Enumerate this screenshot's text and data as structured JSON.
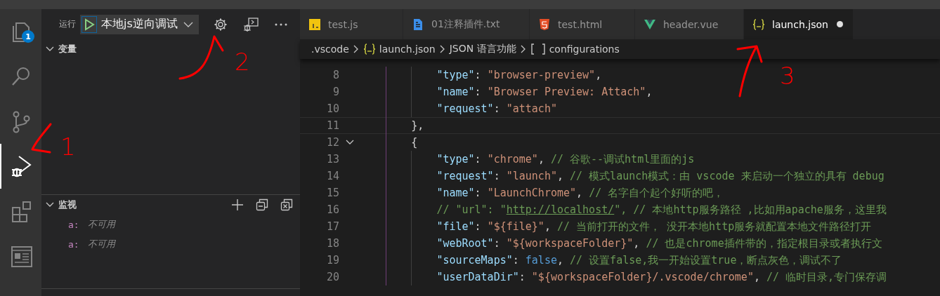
{
  "activity_bar": [
    {
      "kind": "explorer",
      "selected": false,
      "badge": "1"
    },
    {
      "kind": "search",
      "selected": false
    },
    {
      "kind": "source-control",
      "selected": false
    },
    {
      "kind": "run-debug",
      "selected": true
    },
    {
      "kind": "extensions",
      "selected": false
    },
    {
      "kind": "preview",
      "selected": false
    }
  ],
  "sidebar": {
    "title": "运行",
    "run_config": "本地js逆向调试",
    "sections": [
      {
        "title": "变量",
        "expanded": true
      },
      {
        "title": "监视",
        "expanded": true,
        "items": [
          {
            "name": "a:",
            "value": "不可用"
          },
          {
            "name": "a:",
            "value": "不可用"
          }
        ]
      }
    ]
  },
  "tabs": [
    {
      "label": "test.js",
      "kind": "js",
      "selected": false,
      "modified": false
    },
    {
      "label": "01注释插件.txt",
      "kind": "text",
      "selected": false,
      "modified": false
    },
    {
      "label": "test.html",
      "kind": "html",
      "selected": false,
      "modified": false
    },
    {
      "label": "header.vue",
      "kind": "vue",
      "selected": false,
      "modified": false
    },
    {
      "label": "launch.json",
      "kind": "json",
      "selected": true,
      "modified": true
    }
  ],
  "breadcrumbs": [
    {
      "label": ".vscode",
      "kind": "folder"
    },
    {
      "label": "launch.json",
      "kind": "json"
    },
    {
      "label": "JSON 语言功能",
      "kind": "section"
    },
    {
      "label": "configurations",
      "kind": "array"
    }
  ],
  "code": [
    {
      "number": "8",
      "foldable": false,
      "current": false,
      "tokens": [
        {
          "kind": "key",
          "text": "            \"type\""
        },
        {
          "kind": "punct",
          "text": ": "
        },
        {
          "kind": "string",
          "text": "\"browser-preview\""
        },
        {
          "kind": "punct",
          "text": ","
        }
      ]
    },
    {
      "number": "9",
      "foldable": false,
      "current": false,
      "tokens": [
        {
          "kind": "key",
          "text": "            \"name\""
        },
        {
          "kind": "punct",
          "text": ": "
        },
        {
          "kind": "string",
          "text": "\"Browser Preview: Attach\""
        },
        {
          "kind": "punct",
          "text": ","
        }
      ]
    },
    {
      "number": "10",
      "foldable": false,
      "current": false,
      "tokens": [
        {
          "kind": "key",
          "text": "            \"request\""
        },
        {
          "kind": "punct",
          "text": ": "
        },
        {
          "kind": "string",
          "text": "\"attach\""
        }
      ]
    },
    {
      "number": "11",
      "foldable": false,
      "current": true,
      "tokens": [
        {
          "kind": "punct",
          "text": "        },"
        }
      ]
    },
    {
      "number": "12",
      "foldable": true,
      "current": false,
      "tokens": [
        {
          "kind": "punct",
          "text": "        {"
        }
      ]
    },
    {
      "number": "13",
      "foldable": false,
      "current": false,
      "tokens": [
        {
          "kind": "key",
          "text": "            \"type\""
        },
        {
          "kind": "punct",
          "text": ": "
        },
        {
          "kind": "string",
          "text": "\"chrome\""
        },
        {
          "kind": "punct",
          "text": ", "
        },
        {
          "kind": "comment",
          "text": "// 谷歌--调试html里面的js"
        }
      ]
    },
    {
      "number": "14",
      "foldable": false,
      "current": false,
      "tokens": [
        {
          "kind": "key",
          "text": "            \"request\""
        },
        {
          "kind": "punct",
          "text": ": "
        },
        {
          "kind": "string",
          "text": "\"launch\""
        },
        {
          "kind": "punct",
          "text": ", "
        },
        {
          "kind": "comment",
          "text": "// 模式launch模式：由 vscode 来启动一个独立的具有 debug"
        }
      ]
    },
    {
      "number": "15",
      "foldable": false,
      "current": false,
      "tokens": [
        {
          "kind": "key",
          "text": "            \"name\""
        },
        {
          "kind": "punct",
          "text": ": "
        },
        {
          "kind": "string",
          "text": "\"LaunchChrome\""
        },
        {
          "kind": "punct",
          "text": ", "
        },
        {
          "kind": "comment",
          "text": "// 名字自个起个好听的吧，"
        }
      ]
    },
    {
      "number": "16",
      "foldable": false,
      "current": false,
      "tokens": [
        {
          "kind": "comment",
          "text": "            // \"url\": \""
        },
        {
          "kind": "link",
          "text": "http://localhost/"
        },
        {
          "kind": "comment",
          "text": "\", // 本地http服务路径 ,比如用apache服务，这里我"
        }
      ]
    },
    {
      "number": "17",
      "foldable": false,
      "current": false,
      "tokens": [
        {
          "kind": "key",
          "text": "            \"file\""
        },
        {
          "kind": "punct",
          "text": ": "
        },
        {
          "kind": "string",
          "text": "\"${file}\""
        },
        {
          "kind": "punct",
          "text": ", "
        },
        {
          "kind": "comment",
          "text": "// 当前打开的文件， 没开本地http服务就配置本地文件路径打开"
        }
      ]
    },
    {
      "number": "18",
      "foldable": false,
      "current": false,
      "tokens": [
        {
          "kind": "key",
          "text": "            \"webRoot\""
        },
        {
          "kind": "punct",
          "text": ": "
        },
        {
          "kind": "string",
          "text": "\"${workspaceFolder}\""
        },
        {
          "kind": "punct",
          "text": ", "
        },
        {
          "kind": "comment",
          "text": "// 也是chrome插件带的，指定根目录或者执行文"
        }
      ]
    },
    {
      "number": "19",
      "foldable": false,
      "current": false,
      "tokens": [
        {
          "kind": "key",
          "text": "            \"sourceMaps\""
        },
        {
          "kind": "punct",
          "text": ": "
        },
        {
          "kind": "keyword",
          "text": "false"
        },
        {
          "kind": "punct",
          "text": ", "
        },
        {
          "kind": "comment",
          "text": "// 设置false,我一开始设置true，断点灰色，调试不了"
        }
      ]
    },
    {
      "number": "20",
      "foldable": false,
      "current": false,
      "tokens": [
        {
          "kind": "key",
          "text": "            \"userDataDir\""
        },
        {
          "kind": "punct",
          "text": ": "
        },
        {
          "kind": "string",
          "text": "\"${workspaceFolder}/.vscode/chrome\""
        },
        {
          "kind": "punct",
          "text": ", "
        },
        {
          "kind": "comment",
          "text": "// 临时目录,专门保存调"
        }
      ]
    }
  ],
  "annotations": [
    {
      "label": "1"
    },
    {
      "label": "2"
    },
    {
      "label": "3"
    }
  ]
}
